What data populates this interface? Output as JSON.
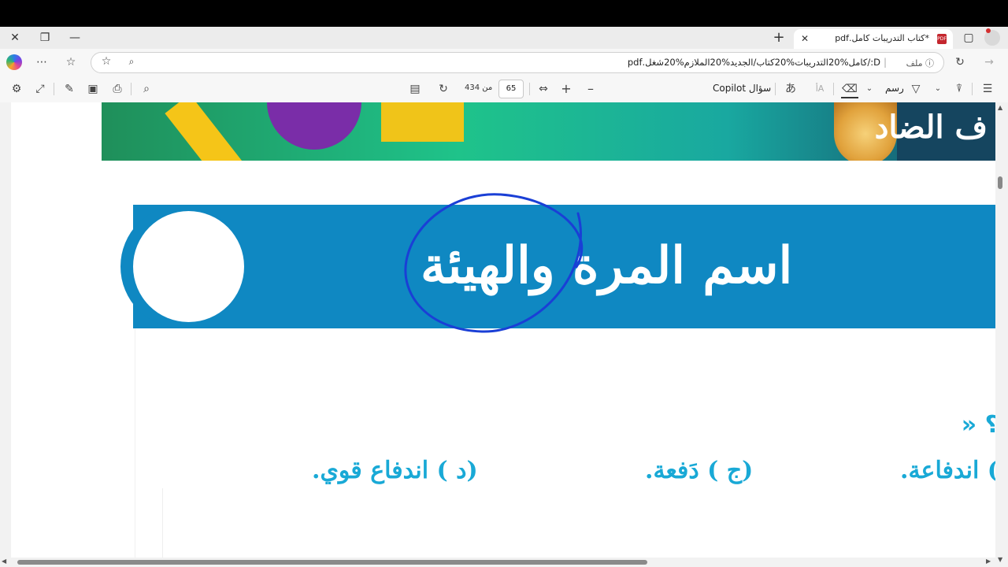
{
  "browser": {
    "tab": {
      "title": "*كتاب التدريبات كامل.pdf",
      "icon": "pdf-file-icon"
    },
    "window_buttons": [
      "close",
      "restore",
      "minimize"
    ],
    "address": {
      "security_label": "ملف",
      "url": "D:/كامل%20التدريبات%20كتاب/الجديد%20الملازم%20شغل.pdf"
    }
  },
  "pdf_toolbar": {
    "page_number": "65",
    "page_total_label": "من 434",
    "copilot_label": "سؤال Copilot",
    "draw_label": "رسم",
    "read_aloud_label": "أA"
  },
  "document": {
    "banner_right_text": "ف الضاد",
    "title": "اسم المرة والهيئة",
    "question_marker": "؟ «",
    "options": [
      {
        "label": ") اندفاعة."
      },
      {
        "label": "(ج ) دَفعة."
      },
      {
        "label": "(د ) اندفاع قوي."
      }
    ]
  },
  "colors": {
    "title_band": "#0f88c2",
    "option_text": "#19a9d6",
    "annotation_ink": "#1a3fd6"
  }
}
